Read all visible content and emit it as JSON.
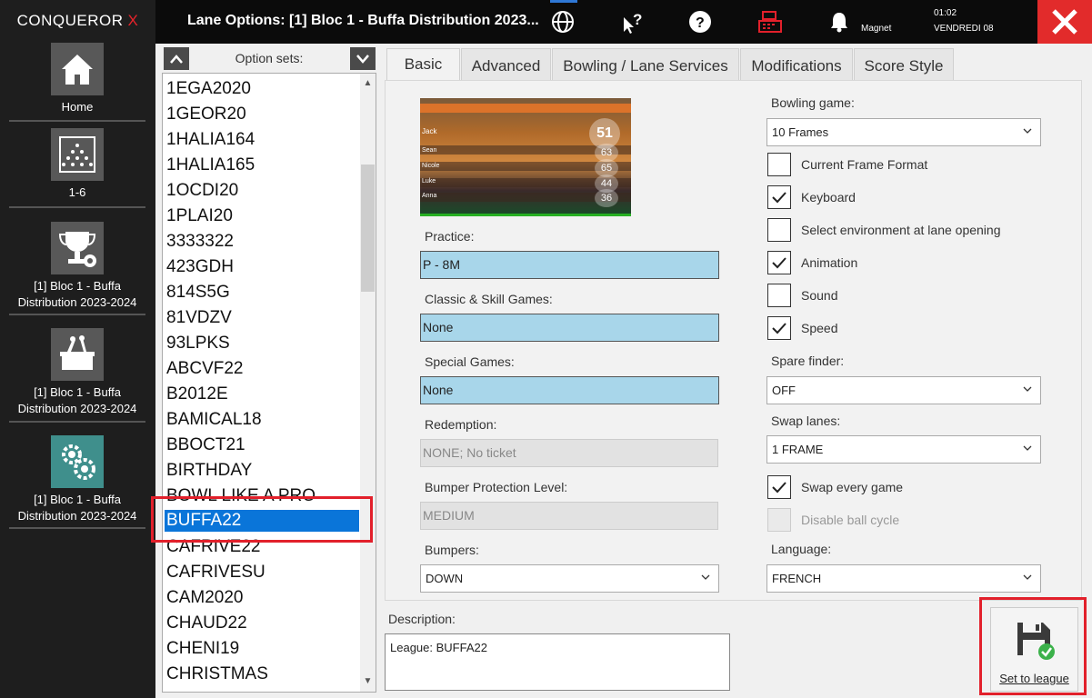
{
  "app": {
    "brand": "CONQUEROR",
    "brand_x": "X"
  },
  "header": {
    "title": "Lane Options: [1] Bloc 1 - Buffa Distribution 2023...",
    "user": "Magnet",
    "time": "01:02",
    "date": "VENDREDI 08"
  },
  "sidebar": {
    "items": [
      {
        "label": "Home"
      },
      {
        "label": "1-6"
      },
      {
        "label": "[1] Bloc 1 - Buffa Distribution 2023-2024"
      },
      {
        "label": "[1] Bloc 1 - Buffa Distribution 2023-2024"
      },
      {
        "label": "[1] Bloc 1 - Buffa Distribution 2023-2024"
      }
    ]
  },
  "option_sets": {
    "label": "Option sets:",
    "items": [
      "1EGA2020",
      "1GEOR20",
      "1HALIA164",
      "1HALIA165",
      "1OCDI20",
      "1PLAI20",
      "3333322",
      "423GDH",
      "814S5G",
      "81VDZV",
      "93LPKS",
      "ABCVF22",
      "B2012E",
      "BAMICAL18",
      "BBOCT21",
      "BIRTHDAY",
      "BOWL LIKE A PRO",
      "BUFFA22",
      "CAFRIVE22",
      "CAFRIVESU",
      "CAM2020",
      "CHAUD22",
      "CHENI19",
      "CHRISTMAS"
    ],
    "selected": "BUFFA22"
  },
  "tabs": [
    "Basic",
    "Advanced",
    "Bowling / Lane Services",
    "Modifications",
    "Score Style"
  ],
  "preview": {
    "scores": [
      "51",
      "63",
      "65",
      "44",
      "36"
    ],
    "names": [
      "Jack",
      "Sean",
      "Nicole",
      "Luke",
      "Anna"
    ]
  },
  "basic": {
    "practice": {
      "label": "Practice:",
      "value": "P - 8M"
    },
    "classic": {
      "label": "Classic & Skill Games:",
      "value": "None"
    },
    "special": {
      "label": "Special Games:",
      "value": "None"
    },
    "redemption": {
      "label": "Redemption:",
      "value": "NONE; No ticket"
    },
    "bumper_level": {
      "label": "Bumper Protection Level:",
      "value": "MEDIUM"
    },
    "bumpers": {
      "label": "Bumpers:",
      "value": "DOWN"
    },
    "bowling_game": {
      "label": "Bowling game:",
      "value": "10 Frames"
    },
    "checks": [
      {
        "label": "Current Frame Format",
        "checked": false,
        "disabled": false
      },
      {
        "label": "Keyboard",
        "checked": true,
        "disabled": false
      },
      {
        "label": "Select environment at lane opening",
        "checked": false,
        "disabled": false
      },
      {
        "label": "Animation",
        "checked": true,
        "disabled": false
      },
      {
        "label": "Sound",
        "checked": false,
        "disabled": false
      },
      {
        "label": "Speed",
        "checked": true,
        "disabled": false
      }
    ],
    "spare_finder": {
      "label": "Spare finder:",
      "value": "OFF"
    },
    "swap_lanes": {
      "label": "Swap lanes:",
      "value": "1 FRAME"
    },
    "swap_every": {
      "label": "Swap every game",
      "checked": true
    },
    "disable_ball": {
      "label": "Disable ball cycle",
      "checked": false,
      "disabled": true
    },
    "language": {
      "label": "Language:",
      "value": "FRENCH"
    }
  },
  "description": {
    "label": "Description:",
    "value": "League: BUFFA22"
  },
  "save": {
    "label": "Set to league"
  },
  "colors": {
    "accent": "#0a75d9",
    "close": "#e22b2b",
    "field_blue": "#a8d6ea",
    "highlight": "#e2202b"
  }
}
